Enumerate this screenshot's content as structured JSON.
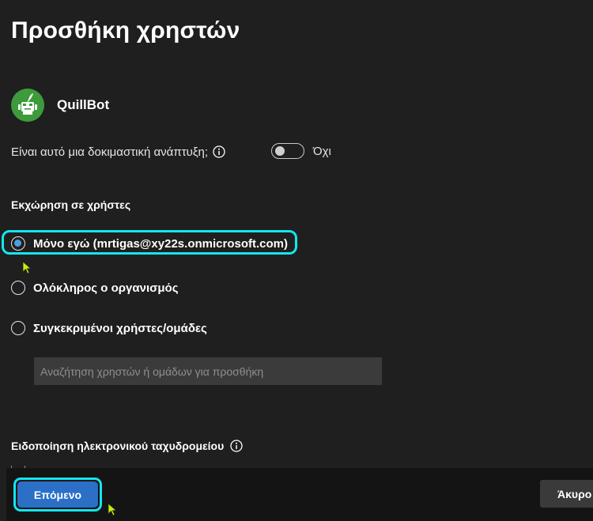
{
  "page": {
    "title": "Προσθήκη χρηστών"
  },
  "app": {
    "name": "QuillBot",
    "logo_color": "#3d9b3c"
  },
  "test_deployment": {
    "question": "Είναι αυτό μια δοκιμαστική ανάπτυξη;",
    "info_icon": "info-icon",
    "toggle_state": false,
    "toggle_label": "Όχι"
  },
  "assignment": {
    "label": "Εκχώρηση σε χρήστες",
    "options": [
      {
        "label": "Μόνο εγώ (mrtigas@xy22s.onmicrosoft.com)",
        "checked": true
      },
      {
        "label": "Ολόκληρος ο οργανισμός",
        "checked": false
      },
      {
        "label": "Συγκεκριμένοι χρήστες/ομάδες",
        "checked": false
      }
    ],
    "search_placeholder": "Αναζήτηση χρηστών ή ομάδων για προσθήκη",
    "search_value": ""
  },
  "email_notification": {
    "label": "Ειδοποίηση ηλεκτρονικού ταχυδρομείου",
    "info_icon": "info-icon"
  },
  "footer": {
    "next_label": "Επόμενο",
    "cancel_label": "Άκυρο"
  },
  "colors": {
    "background": "#1f1f1f",
    "accent": "#2b6fc7",
    "focus_ring": "#12e6f0",
    "radio_dot": "#4a9fe0",
    "cursor": "#c8f000"
  }
}
